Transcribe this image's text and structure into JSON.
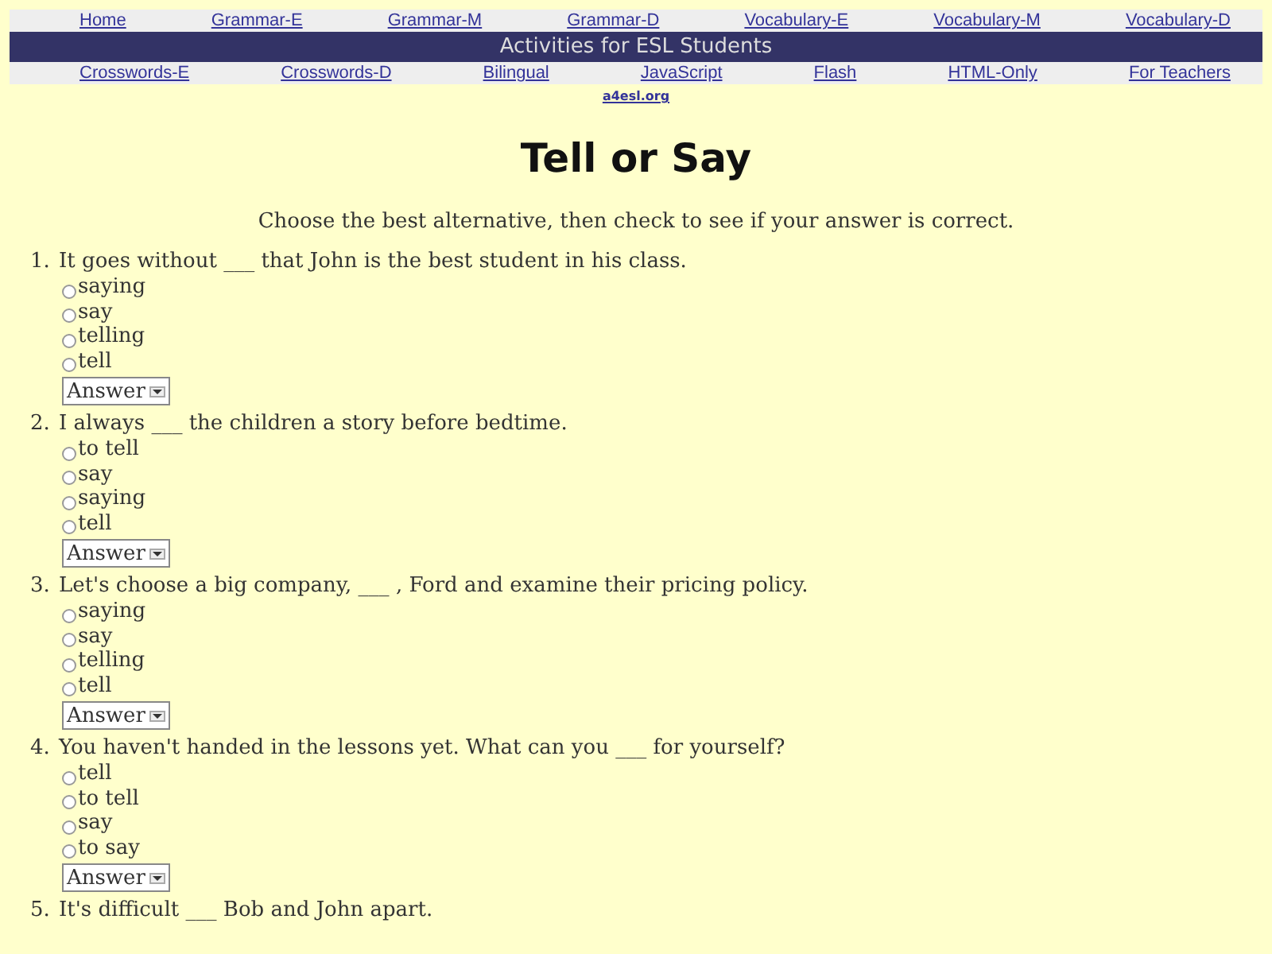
{
  "nav_top": [
    "Home",
    "Grammar-E",
    "Grammar-M",
    "Grammar-D",
    "Vocabulary-E",
    "Vocabulary-M",
    "Vocabulary-D"
  ],
  "banner": "Activities for ESL Students",
  "nav_bottom": [
    "Crosswords-E",
    "Crosswords-D",
    "Bilingual",
    "JavaScript",
    "Flash",
    "HTML-Only",
    "For Teachers"
  ],
  "site_link": "a4esl.org",
  "title": "Tell or Say",
  "instructions": "Choose the best alternative, then check to see if your answer is correct.",
  "questions": [
    {
      "number": "1.",
      "text": "It goes without ___ that John is the best student in his class.",
      "options": [
        {
          "label": "saying",
          "selected": false
        },
        {
          "label": "say",
          "selected": false
        },
        {
          "label": "telling",
          "selected": false
        },
        {
          "label": "tell",
          "selected": false
        }
      ],
      "answer_button": "Answer"
    },
    {
      "number": "2.",
      "text": "I always ___ the children a story before bedtime.",
      "options": [
        {
          "label": "to tell",
          "selected": false
        },
        {
          "label": "say",
          "selected": false
        },
        {
          "label": "saying",
          "selected": false
        },
        {
          "label": "tell",
          "selected": false
        }
      ],
      "answer_button": "Answer"
    },
    {
      "number": "3.",
      "text": "Let's choose a big company, ___ , Ford and examine their pricing policy.",
      "options": [
        {
          "label": "saying",
          "selected": false
        },
        {
          "label": "say",
          "selected": false
        },
        {
          "label": "telling",
          "selected": false
        },
        {
          "label": "tell",
          "selected": false
        }
      ],
      "answer_button": "Answer"
    },
    {
      "number": "4.",
      "text": "You haven't handed in the lessons yet. What can you ___ for yourself?",
      "options": [
        {
          "label": "tell",
          "selected": false
        },
        {
          "label": "to tell",
          "selected": false
        },
        {
          "label": "say",
          "selected": false
        },
        {
          "label": "to say",
          "selected": false
        }
      ],
      "answer_button": "Answer"
    },
    {
      "number": "5.",
      "text": "It's difficult ___ Bob and John apart."
    }
  ]
}
